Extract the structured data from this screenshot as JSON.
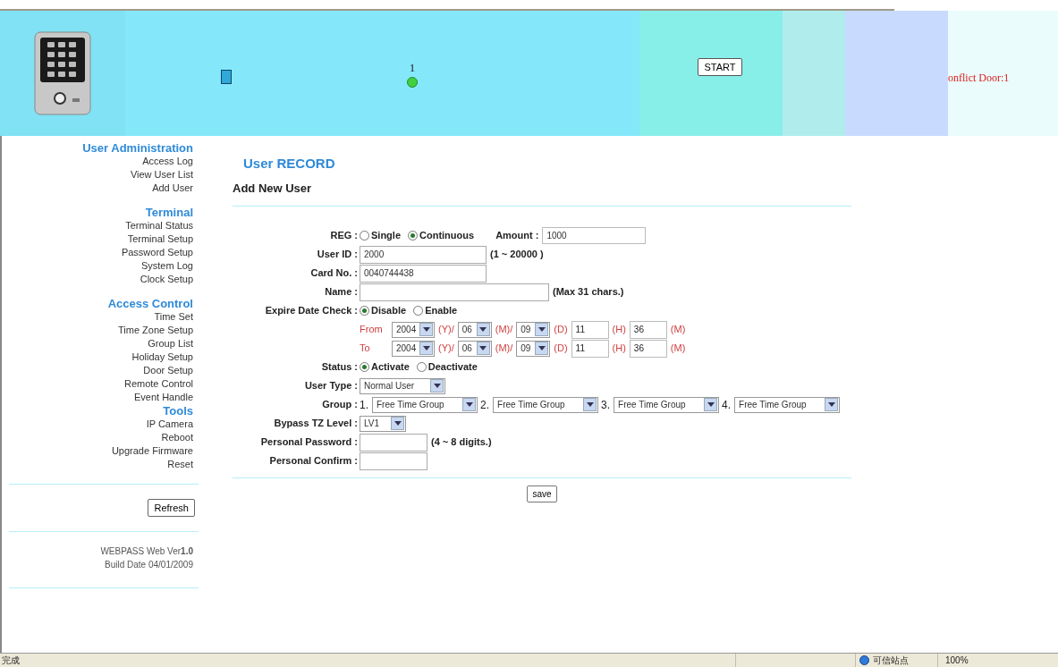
{
  "header": {
    "door_number": "1",
    "door_active": true,
    "start_button": "START",
    "conflict_text": "onflict Door:1"
  },
  "sidebar": {
    "sections": [
      {
        "title": "User Administration",
        "items": [
          "Access Log",
          "View User List",
          "Add User"
        ]
      },
      {
        "title": "Terminal",
        "items": [
          "Terminal Status",
          "Terminal Setup",
          "Password Setup",
          "System Log",
          "Clock Setup"
        ]
      },
      {
        "title": "Access Control",
        "items": [
          "Time Set",
          "Time Zone Setup",
          "Group List",
          "Holiday Setup",
          "Door Setup",
          "Remote Control",
          "Event Handle"
        ]
      },
      {
        "title": "Tools",
        "items": [
          "IP Camera",
          "Reboot",
          "Upgrade Firmware",
          "Reset"
        ]
      }
    ],
    "refresh_button": "Refresh",
    "version": "WEBPASS Web Ver**1.0**",
    "build_date": "Build Date 04/01/2009"
  },
  "page": {
    "title": "User RECORD",
    "subtitle": "Add New User"
  },
  "form": {
    "rows": [
      {
        "kind": "radio",
        "label": "REG :",
        "options": [
          {
            "label": "Single",
            "selected": false
          },
          {
            "label": "Continuous",
            "selected": true
          }
        ],
        "extra_label": "Amount :",
        "extra_value": "1000"
      },
      {
        "kind": "text",
        "label": "User ID :",
        "value": "2000",
        "hint": "(1 ~ 20000 )"
      },
      {
        "kind": "text",
        "label": "Card No. :",
        "value": "0040744438"
      },
      {
        "kind": "longtext",
        "label": "Name :",
        "hint": "(Max 31 chars.)"
      },
      {
        "kind": "radio",
        "label": "Expire Date Check :",
        "options": [
          {
            "label": "Disable",
            "selected": true
          },
          {
            "label": "Enable",
            "selected": false
          }
        ]
      },
      {
        "kind": "date",
        "prefix": "From",
        "parts": [
          {
            "kind": "select",
            "value": "2004"
          },
          {
            "kind": "unit",
            "text": "(Y)/"
          },
          {
            "kind": "select",
            "value": "06"
          },
          {
            "kind": "unit",
            "text": "(M)/"
          },
          {
            "kind": "select",
            "value": "09"
          },
          {
            "kind": "unit",
            "text": "(D)"
          },
          {
            "kind": "input",
            "value": "11"
          },
          {
            "kind": "unit",
            "text": "(H)"
          },
          {
            "kind": "input",
            "value": "36"
          },
          {
            "kind": "unit",
            "text": "(M)"
          }
        ]
      },
      {
        "kind": "date",
        "prefix": "To",
        "parts": [
          {
            "kind": "select",
            "value": "2004"
          },
          {
            "kind": "unit",
            "text": "(Y)/"
          },
          {
            "kind": "select",
            "value": "06"
          },
          {
            "kind": "unit",
            "text": "(M)/"
          },
          {
            "kind": "select",
            "value": "09"
          },
          {
            "kind": "unit",
            "text": "(D)"
          },
          {
            "kind": "input",
            "value": "11"
          },
          {
            "kind": "unit",
            "text": "(H)"
          },
          {
            "kind": "input",
            "value": "36"
          },
          {
            "kind": "unit",
            "text": "(M)"
          }
        ]
      },
      {
        "kind": "radio",
        "label": "Status :",
        "options": [
          {
            "label": "Activate",
            "selected": true
          },
          {
            "label": "Deactivate",
            "selected": false
          }
        ]
      },
      {
        "kind": "select",
        "label": "User Type :",
        "value": "Normal User"
      },
      {
        "kind": "groups",
        "label": "Group :",
        "items": [
          {
            "number": "1.",
            "value": "Free Time Group"
          },
          {
            "number": "2.",
            "value": "Free Time Group"
          },
          {
            "number": "3.",
            "value": "Free Time Group"
          },
          {
            "number": "4.",
            "value": "Free Time Group"
          }
        ]
      },
      {
        "kind": "select",
        "label": "Bypass TZ Level :",
        "value": "LV1"
      },
      {
        "kind": "password",
        "label": "Personal Password :",
        "hint": "(4 ~ 8 digits.)"
      },
      {
        "kind": "password",
        "label": "Personal Confirm :"
      }
    ],
    "save_button": "save"
  },
  "status_bar": {
    "left": "完成",
    "zone": "可信站点",
    "zoom": "100%"
  }
}
